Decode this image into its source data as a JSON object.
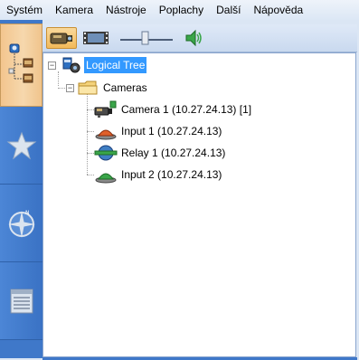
{
  "menu": {
    "items": [
      "Systém",
      "Kamera",
      "Nástroje",
      "Poplachy",
      "Další",
      "Nápověda"
    ]
  },
  "leftnav": {
    "items": [
      {
        "icon": "tree-view-icon",
        "active": true
      },
      {
        "icon": "star-icon",
        "active": false
      },
      {
        "icon": "compass-icon",
        "active": false
      },
      {
        "icon": "list-icon",
        "active": false
      }
    ]
  },
  "toolbar": {
    "buttons": [
      "camera-icon",
      "video-film-icon",
      "volume-slider",
      "speaker-icon"
    ]
  },
  "tree": {
    "root": {
      "label": "Logical Tree",
      "expanded": true
    },
    "cameras": {
      "label": "Cameras",
      "expanded": true
    },
    "children": [
      {
        "label": "Camera 1 (10.27.24.13) [1]",
        "icon": "camera-device-icon"
      },
      {
        "label": "Input 1 (10.27.24.13)",
        "icon": "input-red-icon"
      },
      {
        "label": "Relay 1 (10.27.24.13)",
        "icon": "relay-icon"
      },
      {
        "label": "Input 2 (10.27.24.13)",
        "icon": "input-green-icon"
      }
    ]
  }
}
